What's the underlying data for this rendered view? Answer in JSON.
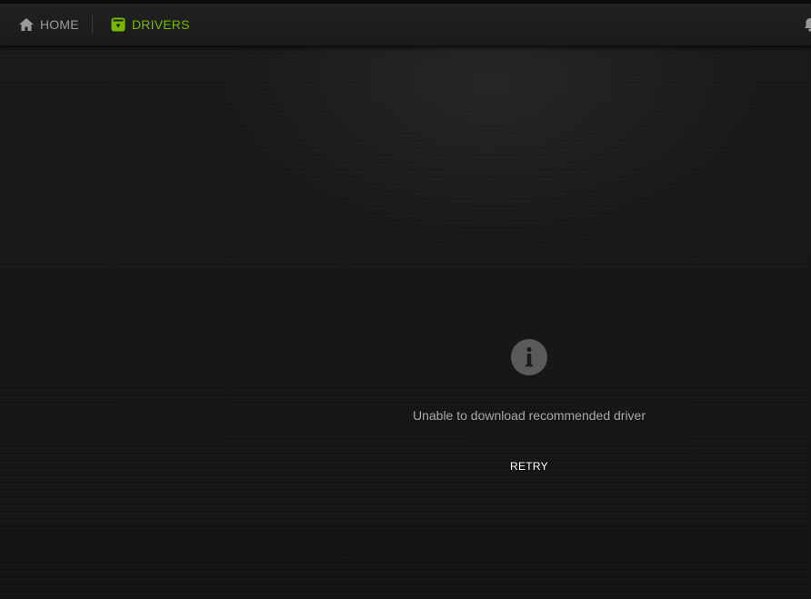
{
  "nav": {
    "home_label": "HOME",
    "drivers_label": "DRIVERS",
    "home_icon": "home-icon",
    "drivers_icon": "driver-download-icon",
    "notification_icon": "bell-icon"
  },
  "status": {
    "icon": "info-icon",
    "message": "Unable to download recommended driver",
    "retry_label": "RETRY"
  },
  "colors": {
    "accent": "#76b900",
    "background": "#141414",
    "navbar": "#1e1e1e",
    "inactive_text": "#9a9a9a",
    "message_text": "#a9a9a9",
    "icon_circle": "#5a5a5a"
  }
}
